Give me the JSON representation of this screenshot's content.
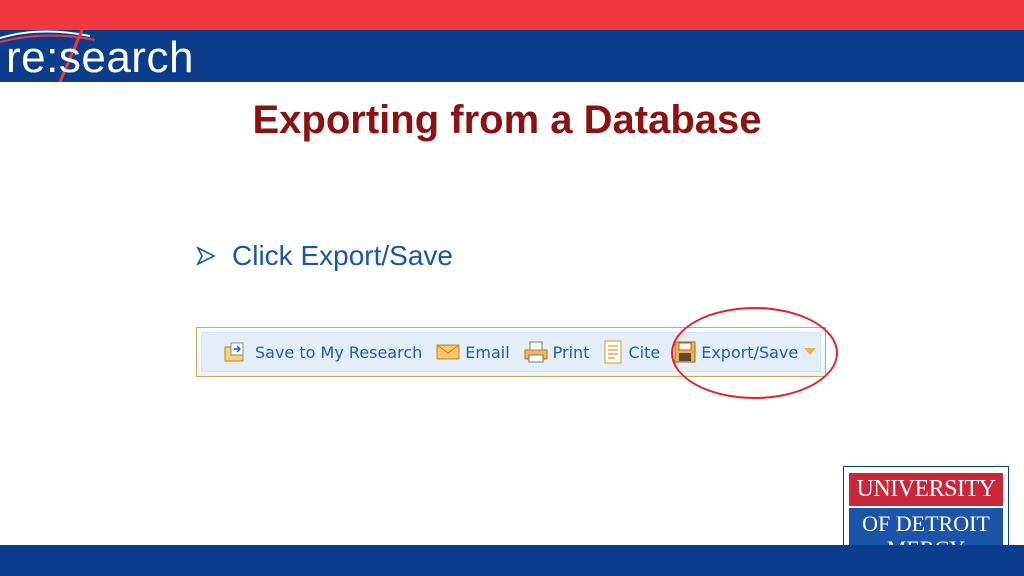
{
  "header": {
    "logo_text": "re:search",
    "colors": {
      "red_bar": "#f0393e",
      "blue_bar": "#0b3d8c"
    }
  },
  "slide": {
    "title": "Exporting from a Database",
    "bullet": "Click Export/Save"
  },
  "toolbar": {
    "items": [
      {
        "label": "Save to My Research",
        "icon": "save-to-folder-icon"
      },
      {
        "label": "Email",
        "icon": "envelope-icon"
      },
      {
        "label": "Print",
        "icon": "printer-icon"
      },
      {
        "label": "Cite",
        "icon": "document-icon"
      },
      {
        "label": "Export/Save",
        "icon": "floppy-disk-icon"
      }
    ]
  },
  "footer_logo": {
    "line_top": "UNIVERSITY",
    "line_mid": "OF DETROIT",
    "line_bottom": "MERCY"
  }
}
